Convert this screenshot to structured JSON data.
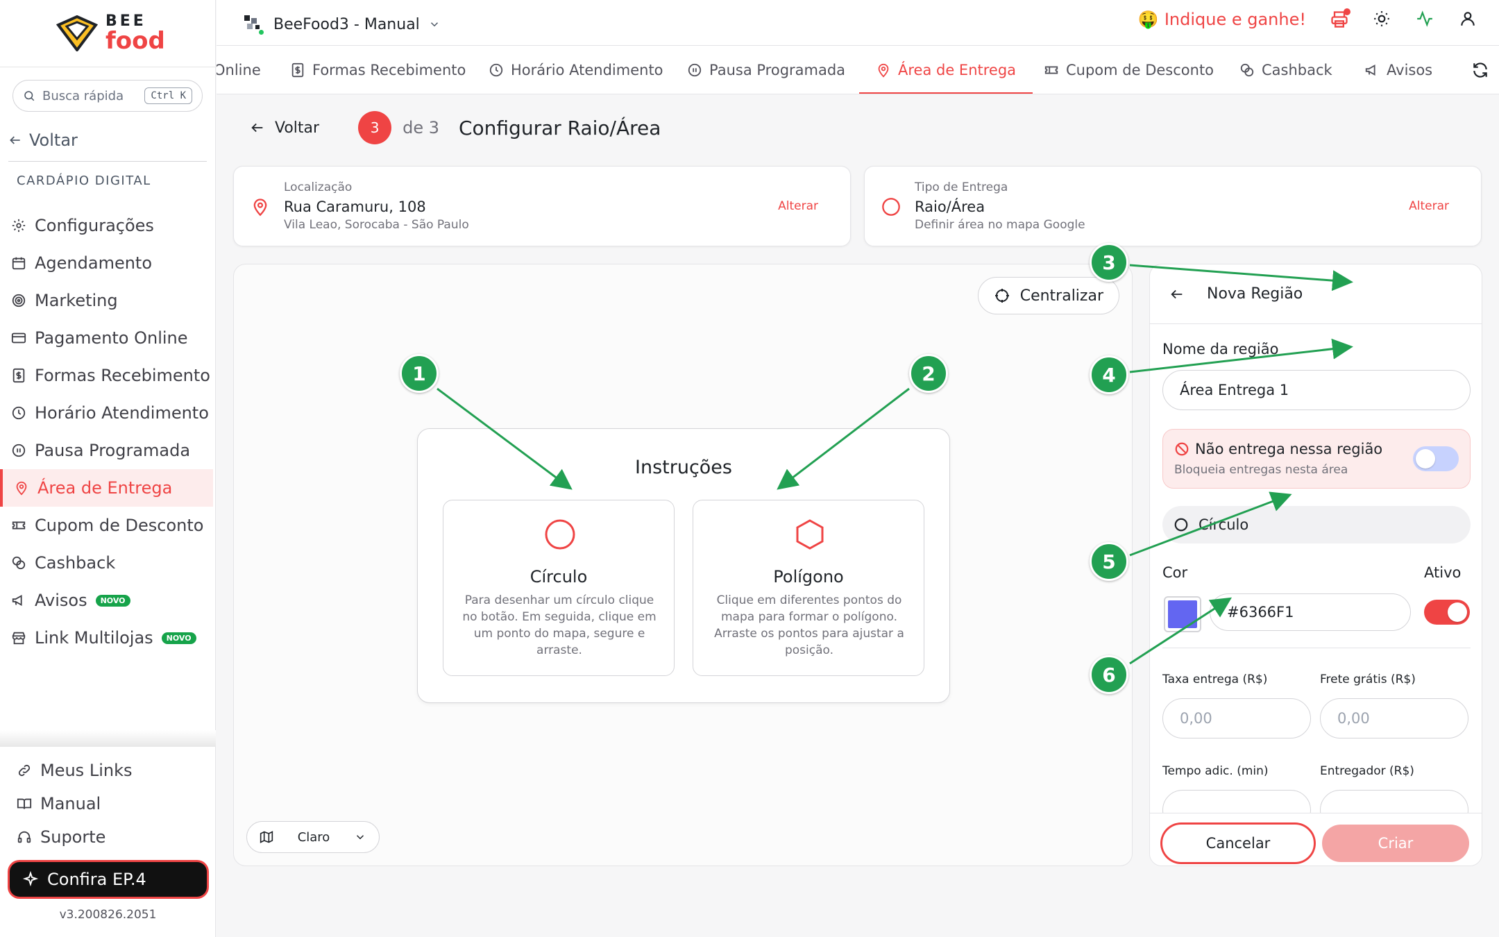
{
  "brand": {
    "logo_top": "BEE",
    "logo_bottom": "food"
  },
  "search": {
    "placeholder": "Busca rápida",
    "shortcut": "Ctrl K"
  },
  "sidebar": {
    "back_label": "Voltar",
    "section_title": "CARDÁPIO DIGITAL",
    "items": [
      {
        "label": "Configurações",
        "icon": "gear-icon"
      },
      {
        "label": "Agendamento",
        "icon": "calendar-icon"
      },
      {
        "label": "Marketing",
        "icon": "target-icon"
      },
      {
        "label": "Pagamento Online",
        "icon": "credit-card-icon"
      },
      {
        "label": "Formas Recebimento",
        "icon": "dollar-receipt-icon"
      },
      {
        "label": "Horário Atendimento",
        "icon": "clock-icon"
      },
      {
        "label": "Pausa Programada",
        "icon": "pause-icon"
      },
      {
        "label": "Área de Entrega",
        "icon": "map-pin-icon",
        "active": true
      },
      {
        "label": "Cupom de Desconto",
        "icon": "ticket-icon"
      },
      {
        "label": "Cashback",
        "icon": "coins-icon"
      },
      {
        "label": "Avisos",
        "icon": "megaphone-icon",
        "badge": "NOVO"
      },
      {
        "label": "Link Multilojas",
        "icon": "store-icon",
        "badge": "NOVO"
      }
    ],
    "bottom_links": [
      {
        "label": "Meus Links",
        "icon": "link-icon"
      },
      {
        "label": "Manual",
        "icon": "book-icon"
      },
      {
        "label": "Suporte",
        "icon": "headset-icon"
      }
    ],
    "cta_label": "Confira EP.4",
    "version": "v3.200826.2051"
  },
  "topbar": {
    "store_name": "BeeFood3 - Manual",
    "referral": "Indique e ganhe!"
  },
  "tabs": [
    {
      "label": "Online",
      "icon": ""
    },
    {
      "label": "Formas Recebimento",
      "icon": "dollar-receipt-icon"
    },
    {
      "label": "Horário Atendimento",
      "icon": "clock-icon"
    },
    {
      "label": "Pausa Programada",
      "icon": "pause-icon"
    },
    {
      "label": "Área de Entrega",
      "icon": "map-pin-icon",
      "active": true
    },
    {
      "label": "Cupom de Desconto",
      "icon": "ticket-icon"
    },
    {
      "label": "Cashback",
      "icon": "coins-icon"
    },
    {
      "label": "Avisos",
      "icon": "megaphone-icon"
    }
  ],
  "step": {
    "back_label": "Voltar",
    "current": "3",
    "of_label": "de 3",
    "title": "Configurar Raio/Área"
  },
  "location_card": {
    "label": "Localização",
    "value": "Rua Caramuru, 108",
    "sub": "Vila Leao, Sorocaba - São Paulo",
    "action": "Alterar"
  },
  "delivery_card": {
    "label": "Tipo de Entrega",
    "value": "Raio/Área",
    "sub": "Definir área no mapa Google",
    "action": "Alterar"
  },
  "map": {
    "center_button": "Centralizar",
    "style_select": "Claro",
    "instructions": {
      "title": "Instruções",
      "circle": {
        "title": "Círculo",
        "desc": "Para desenhar um círculo clique no botão. Em seguida, clique em um ponto do mapa, segure e arraste."
      },
      "polygon": {
        "title": "Polígono",
        "desc": "Clique em diferentes pontos do mapa para formar o polígono. Arraste os pontos para ajustar a posição."
      }
    }
  },
  "panel": {
    "title": "Nova Região",
    "name_label": "Nome da região",
    "name_value": "Área Entrega 1",
    "block_title": "Não entrega nessa região",
    "block_sub": "Bloqueia entregas nesta área",
    "block_enabled": false,
    "shape_label": "Círculo",
    "color_label": "Cor",
    "active_label": "Ativo",
    "active_enabled": true,
    "color_value": "#6366F1",
    "fee_label": "Taxa entrega (R$)",
    "fee_placeholder": "0,00",
    "free_label": "Frete grátis (R$)",
    "free_placeholder": "0,00",
    "time_label": "Tempo adic. (min)",
    "courier_label": "Entregador (R$)",
    "cancel_label": "Cancelar",
    "create_label": "Criar"
  },
  "annotations": [
    "1",
    "2",
    "3",
    "4",
    "5",
    "6"
  ],
  "colors": {
    "accent": "#ef4444",
    "marker": "#22a052",
    "region": "#6366F1"
  }
}
